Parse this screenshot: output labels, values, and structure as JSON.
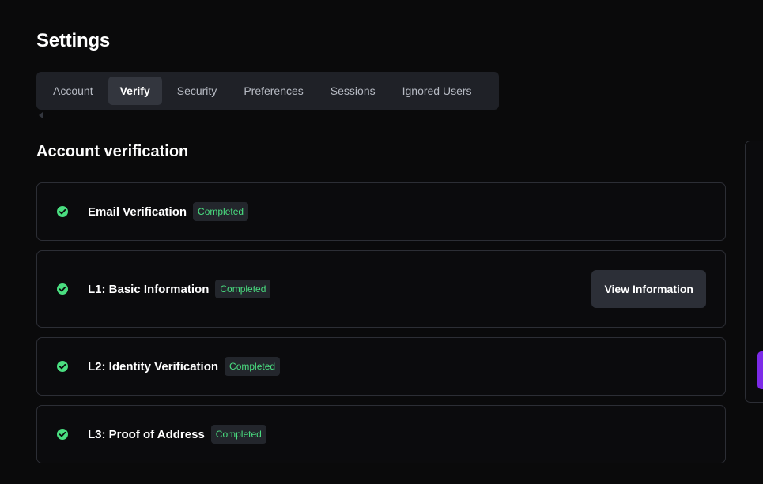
{
  "header": {
    "title": "Settings"
  },
  "tabs": [
    {
      "label": "Account",
      "active": false
    },
    {
      "label": "Verify",
      "active": true
    },
    {
      "label": "Security",
      "active": false
    },
    {
      "label": "Preferences",
      "active": false
    },
    {
      "label": "Sessions",
      "active": false
    },
    {
      "label": "Ignored Users",
      "active": false
    }
  ],
  "verification": {
    "title": "Account verification",
    "steps": [
      {
        "label": "Email Verification",
        "status": "Completed",
        "icon": "check-circle-icon"
      },
      {
        "label": "L1: Basic Information",
        "status": "Completed",
        "icon": "check-circle-icon",
        "action_label": "View Information"
      },
      {
        "label": "L2: Identity Verification",
        "status": "Completed",
        "icon": "check-circle-icon"
      },
      {
        "label": "L3: Proof of Address",
        "status": "Completed",
        "icon": "check-circle-icon"
      }
    ]
  },
  "colors": {
    "background": "#0a0a0b",
    "tab_bar": "#1f2127",
    "tab_active": "#33363e",
    "success": "#4ade80",
    "accent": "#7c2ae8",
    "border": "#2c2e35"
  }
}
